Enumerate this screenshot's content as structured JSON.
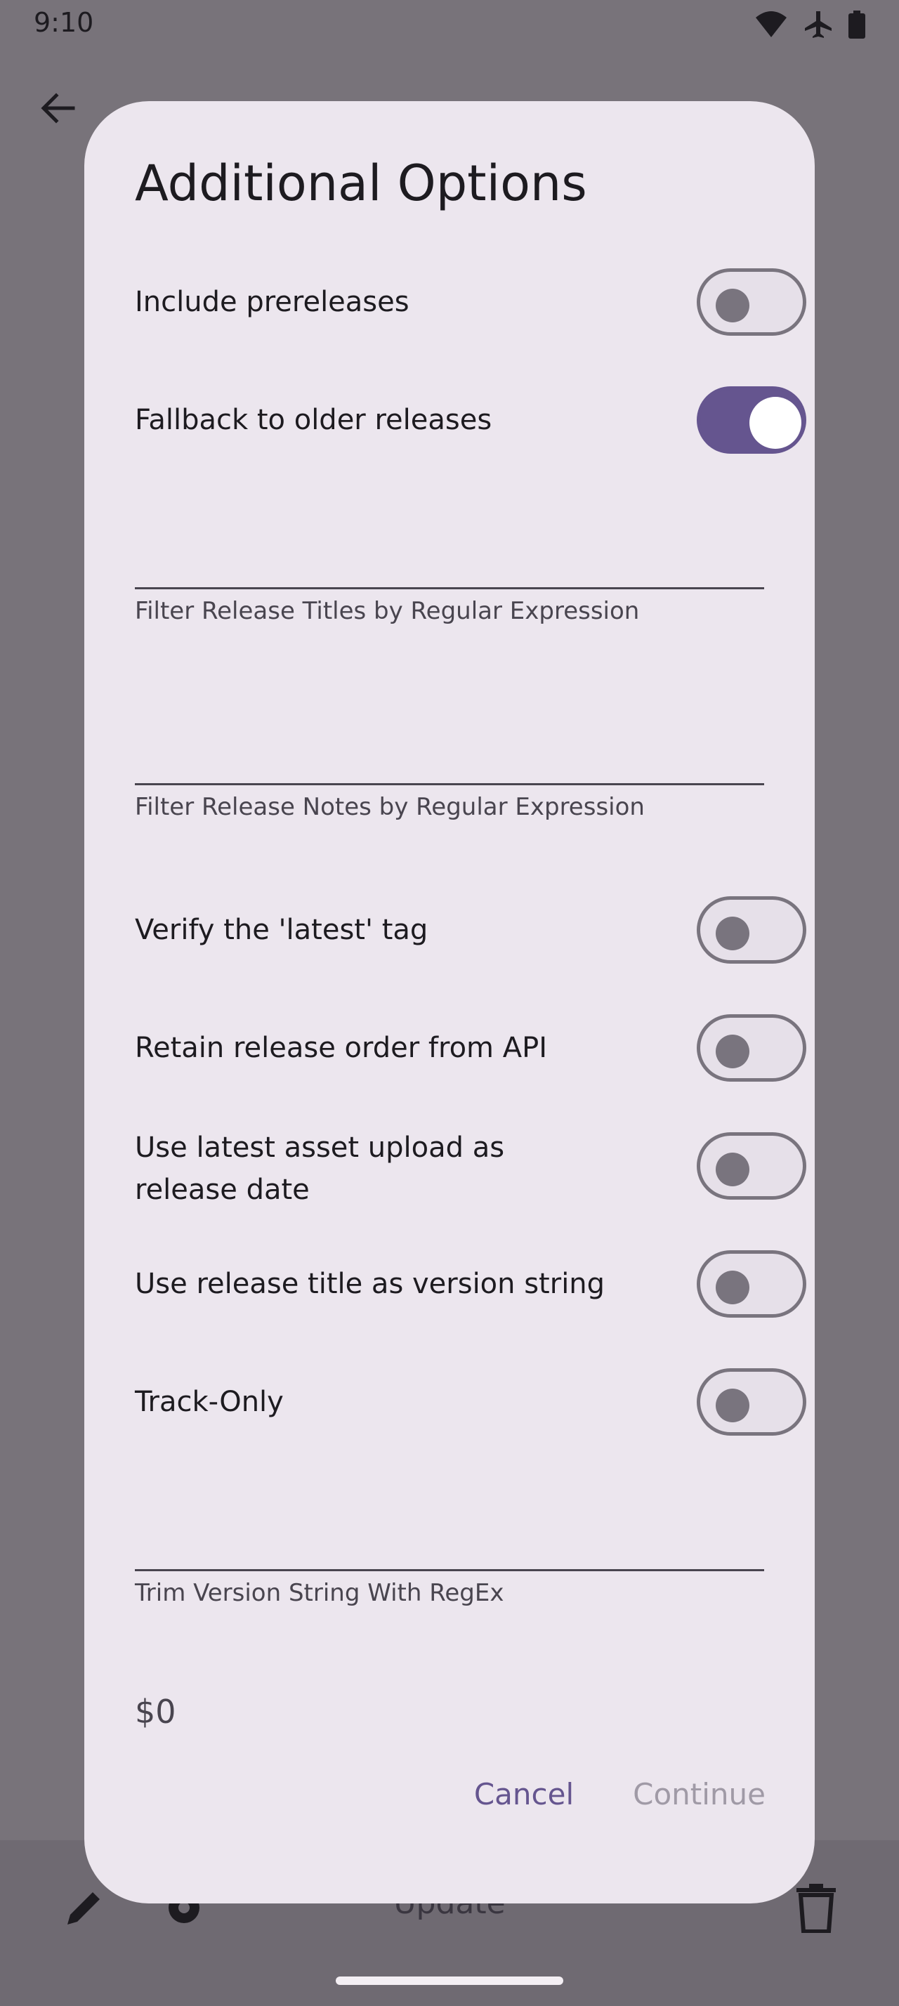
{
  "status_bar": {
    "time": "9:10",
    "icons": [
      "wifi-icon",
      "airplane-icon",
      "battery-icon"
    ]
  },
  "background": {
    "bottom_bar_label": "Update",
    "icons": [
      "back-arrow-icon",
      "edit-icon",
      "gear-icon",
      "delete-icon"
    ]
  },
  "dialog": {
    "title": "Additional Options",
    "toggles": [
      {
        "label": "Include prereleases",
        "on": false
      },
      {
        "label": "Fallback to older releases",
        "on": true
      },
      {
        "label": "Verify the 'latest' tag",
        "on": false
      },
      {
        "label": "Retain release order from API",
        "on": false
      },
      {
        "label": "Use latest asset upload as release date",
        "on": false
      },
      {
        "label": "Use release title as version string",
        "on": false
      },
      {
        "label": "Track-Only",
        "on": false
      }
    ],
    "fields": [
      {
        "label": "Filter Release Titles by Regular Expression",
        "value": ""
      },
      {
        "label": "Filter Release Notes by Regular Expression",
        "value": ""
      },
      {
        "label": "Trim Version String With RegEx",
        "value": ""
      }
    ],
    "match_group_value": "$0",
    "cancel_label": "Cancel",
    "continue_label": "Continue"
  },
  "colors": {
    "scrim": "#78737A",
    "dialog_surface": "#ECE6EE",
    "primary": "#65558F",
    "outline": "#79747E"
  }
}
